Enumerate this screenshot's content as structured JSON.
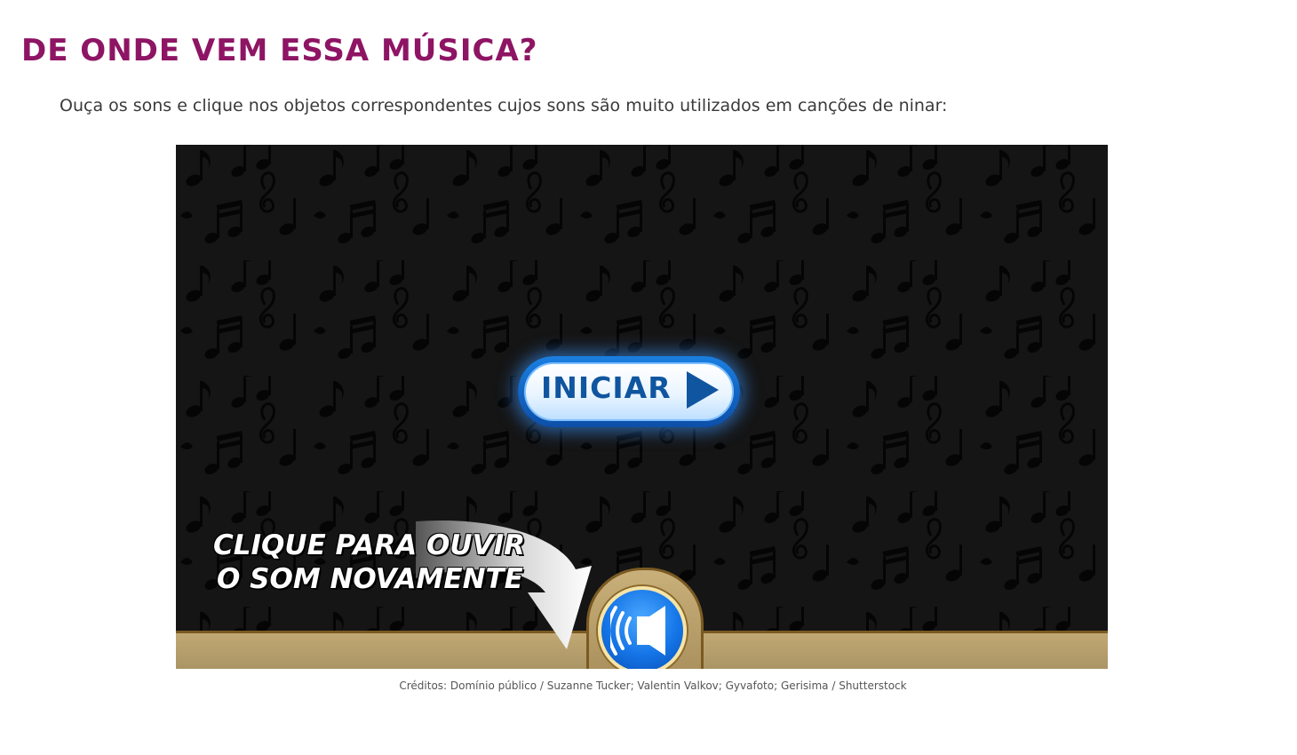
{
  "page": {
    "title": "DE ONDE VEM ESSA MÚSICA?",
    "instructions": "Ouça os sons e clique nos objetos correspondentes cujos sons são muito utilizados em canções de ninar:",
    "credits": "Créditos: Domínio público / Suzanne Tucker; Valentin Valkov; Gyvafoto; Gerisima / Shutterstock"
  },
  "game": {
    "start_label": "INICIAR",
    "hint_line1": "CLIQUE PARA OUVIR",
    "hint_line2": "O SOM NOVAMENTE"
  },
  "icons": {
    "play": "play-triangle-icon",
    "replay": "speaker-icon",
    "background": "music-notes-pattern"
  },
  "colors": {
    "title": "#8e1464",
    "instructions": "#3a3a3a",
    "game_background": "#151515",
    "start_button": "#10559f",
    "replay_button": "#1474e6",
    "bottom_bar": "#b8a06a"
  }
}
